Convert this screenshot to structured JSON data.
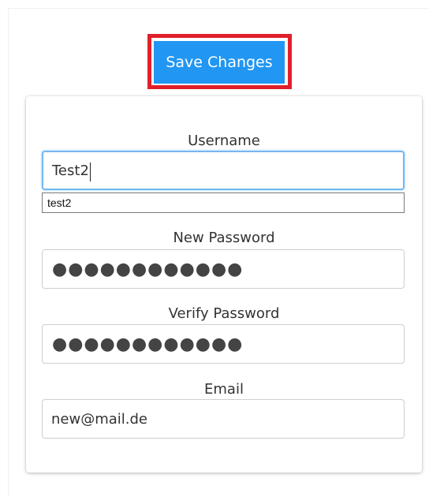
{
  "toolbar": {
    "save_label": "Save Changes"
  },
  "form": {
    "username": {
      "label": "Username",
      "value": "Test2",
      "autocomplete_suggestion": "test2"
    },
    "new_password": {
      "label": "New Password",
      "masked_value": "●●●●●●●●●●●●"
    },
    "verify_password": {
      "label": "Verify Password",
      "masked_value": "●●●●●●●●●●●●"
    },
    "email": {
      "label": "Email",
      "value": "new@mail.de"
    }
  },
  "colors": {
    "primary_button": "#2196f3",
    "highlight_frame": "#e0202a",
    "focus_border": "#74b8f0"
  }
}
